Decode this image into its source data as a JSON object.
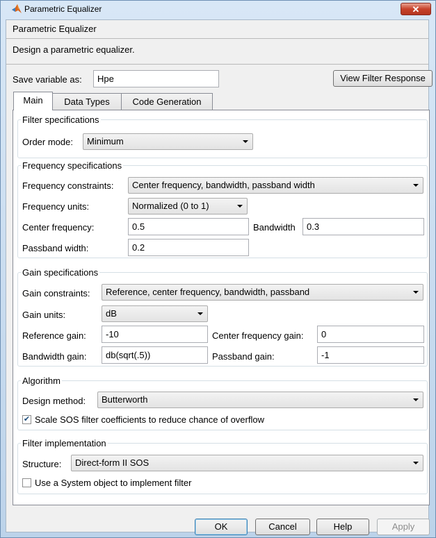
{
  "window": {
    "title": "Parametric Equalizer",
    "close_label": "✕"
  },
  "header": {
    "title": "Parametric Equalizer",
    "description": "Design a parametric equalizer."
  },
  "save": {
    "label": "Save variable as:",
    "value": "Hpe",
    "view_button": "View Filter Response"
  },
  "tabs": [
    {
      "label": "Main"
    },
    {
      "label": "Data Types"
    },
    {
      "label": "Code Generation"
    }
  ],
  "filter_spec": {
    "legend": "Filter specifications",
    "order_mode_label": "Order mode:",
    "order_mode_value": "Minimum"
  },
  "freq_spec": {
    "legend": "Frequency specifications",
    "constraints_label": "Frequency constraints:",
    "constraints_value": "Center frequency, bandwidth, passband width",
    "units_label": "Frequency units:",
    "units_value": "Normalized (0 to 1)",
    "center_label": "Center frequency:",
    "center_value": "0.5",
    "bandwidth_label": "Bandwidth",
    "bandwidth_value": "0.3",
    "passband_label": "Passband width:",
    "passband_value": "0.2"
  },
  "gain_spec": {
    "legend": "Gain specifications",
    "constraints_label": "Gain constraints:",
    "constraints_value": "Reference, center frequency, bandwidth, passband",
    "units_label": "Gain units:",
    "units_value": "dB",
    "ref_label": "Reference gain:",
    "ref_value": "-10",
    "center_label": "Center frequency gain:",
    "center_value": "0",
    "bw_label": "Bandwidth gain:",
    "bw_value": "db(sqrt(.5))",
    "pb_label": "Passband gain:",
    "pb_value": "-1"
  },
  "algorithm": {
    "legend": "Algorithm",
    "method_label": "Design method:",
    "method_value": "Butterworth",
    "scale_label": "Scale SOS filter coefficients to reduce chance of overflow",
    "scale_checked": true
  },
  "implementation": {
    "legend": "Filter implementation",
    "structure_label": "Structure:",
    "structure_value": "Direct-form II SOS",
    "sysobj_label": "Use a System object to implement filter",
    "sysobj_checked": false
  },
  "buttons": {
    "ok": "OK",
    "cancel": "Cancel",
    "help": "Help",
    "apply": "Apply"
  }
}
